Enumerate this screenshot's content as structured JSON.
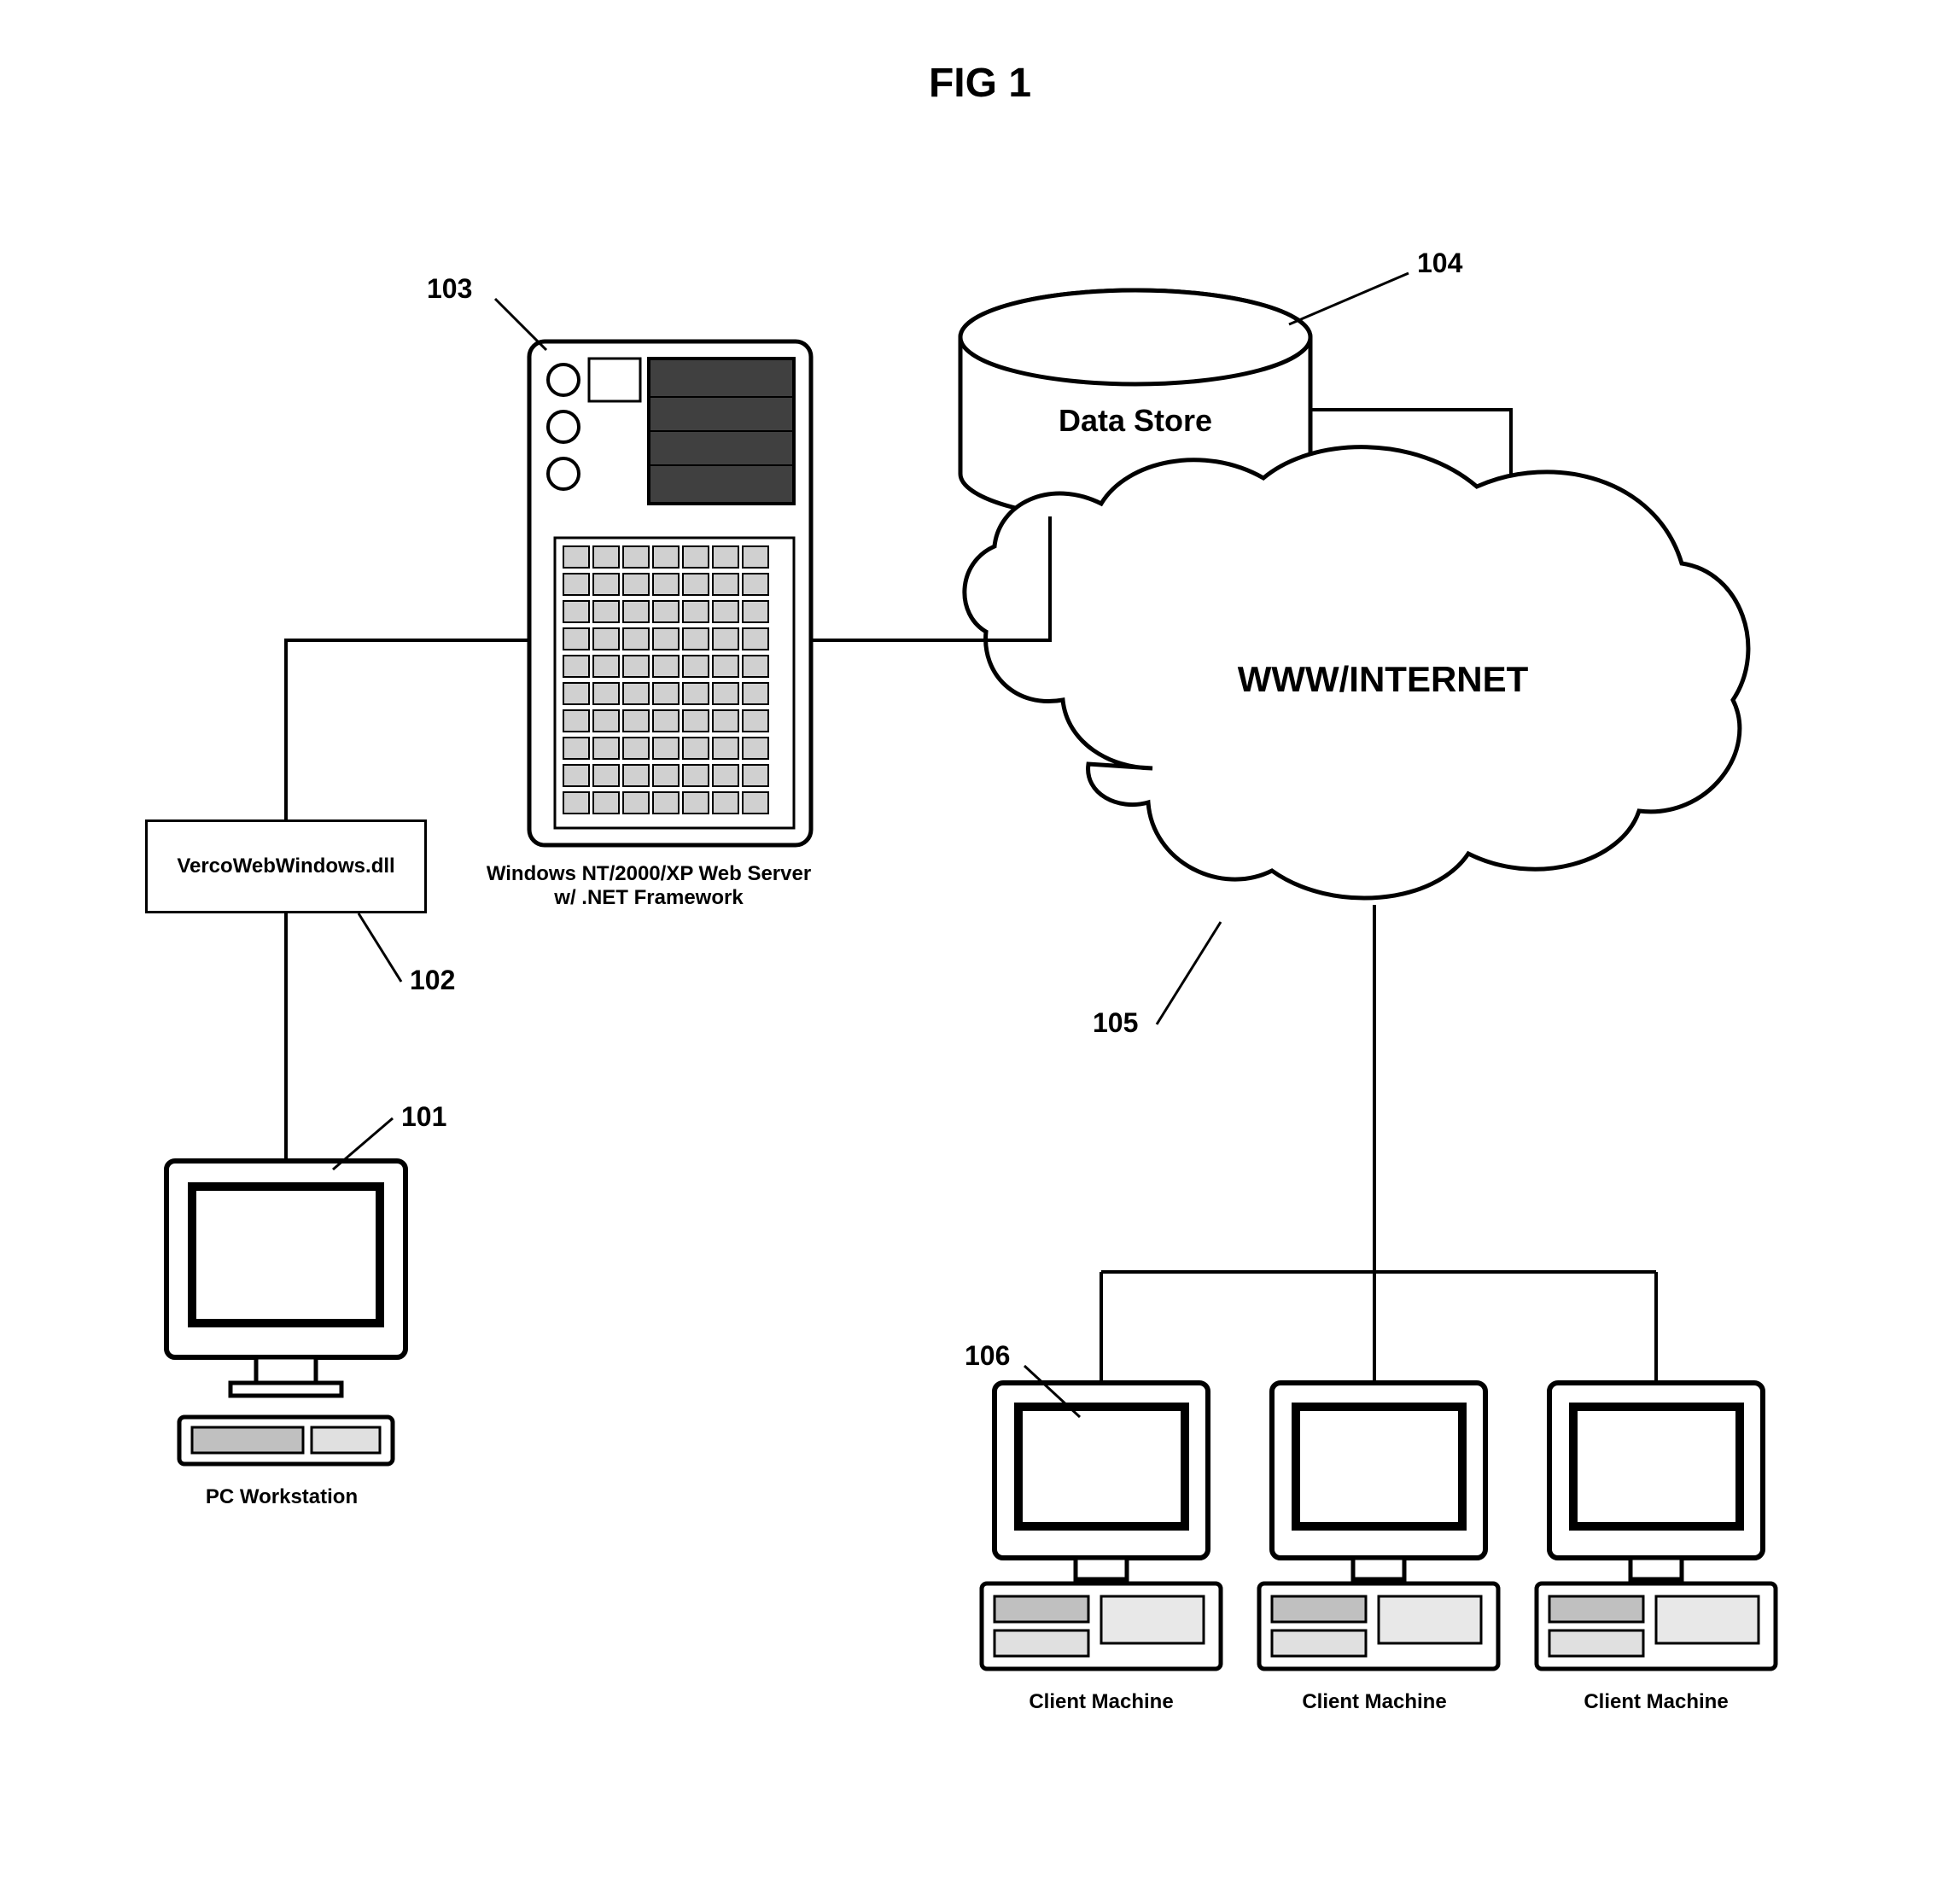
{
  "title": "FIG 1",
  "refs": {
    "r101": "101",
    "r102": "102",
    "r103": "103",
    "r104": "104",
    "r105": "105",
    "r106": "106"
  },
  "labels": {
    "dll": "VercoWebWindows.dll",
    "server": "Windows NT/2000/XP Web Server\nw/ .NET Framework",
    "datastore": "Data Store",
    "internet": "WWW/INTERNET",
    "workstation": "PC Workstation",
    "client": "Client Machine"
  }
}
